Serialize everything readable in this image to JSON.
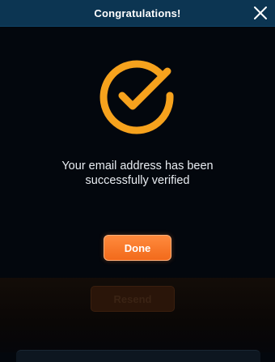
{
  "modal": {
    "title": "Congratulations!",
    "message_line1": "Your email address has been",
    "message_line2": "successfully verified",
    "done_label": "Done",
    "success_icon": "check-circle-icon",
    "close_icon": "close-icon"
  },
  "background": {
    "button_label": "Resend",
    "obscured": true
  },
  "colors": {
    "header": "#0c3552",
    "accent": "#f6a21d",
    "button": "#f26a1b",
    "panel": "#03070d",
    "text": "#e9edf2"
  }
}
